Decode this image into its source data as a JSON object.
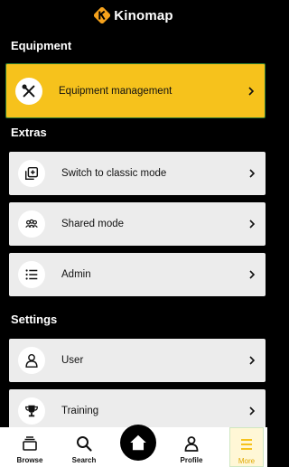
{
  "app": {
    "brand": "Kinomap"
  },
  "sections": {
    "equipment": "Equipment",
    "extras": "Extras",
    "settings": "Settings"
  },
  "rows": {
    "equipment_management": "Equipment management",
    "classic_mode": "Switch to classic mode",
    "shared_mode": "Shared mode",
    "admin": "Admin",
    "user": "User",
    "training": "Training"
  },
  "tabbar": {
    "browse": "Browse",
    "search": "Search",
    "profile": "Profile",
    "more": "More"
  },
  "colors": {
    "accent": "#f6c21c",
    "background": "#000000",
    "row": "#ececec",
    "more_label": "#e0a800"
  },
  "icons": [
    "kinomap-logo-icon",
    "tools-icon",
    "classic-mode-icon",
    "group-icon",
    "list-icon",
    "user-icon",
    "trophy-icon",
    "chevron-right-icon",
    "browse-icon",
    "search-icon",
    "home-icon",
    "profile-icon",
    "menu-icon"
  ]
}
